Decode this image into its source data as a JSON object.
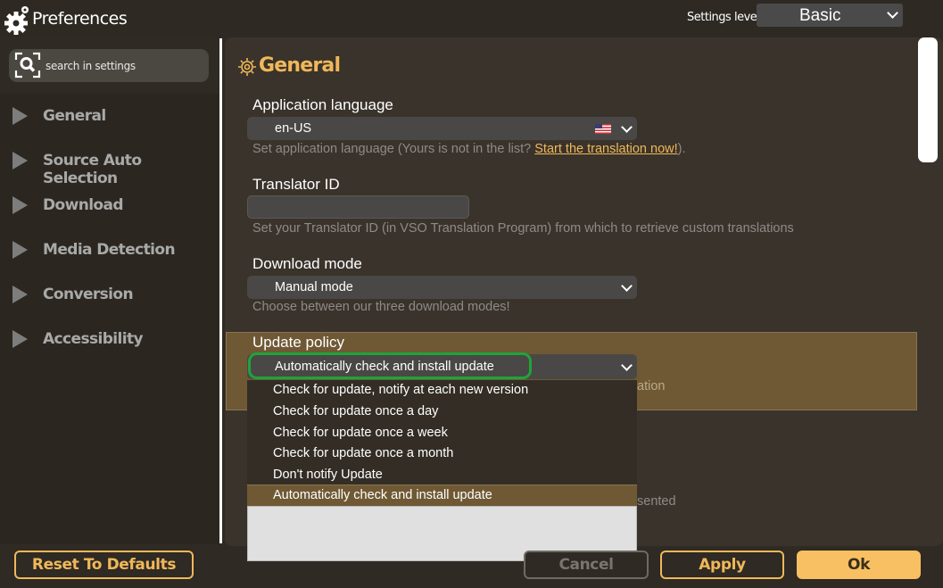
{
  "window": {
    "title": "Preferences"
  },
  "settings_level": {
    "label": "Settings level",
    "value": "Basic"
  },
  "search": {
    "placeholder": "search in settings"
  },
  "sidebar": {
    "items": [
      {
        "label": "General"
      },
      {
        "label": "Source Auto Selection"
      },
      {
        "label": "Download"
      },
      {
        "label": "Media Detection"
      },
      {
        "label": "Conversion"
      },
      {
        "label": "Accessibility"
      }
    ]
  },
  "section": {
    "title": "General"
  },
  "app_language": {
    "label": "Application language",
    "value": "en-US",
    "hint_prefix": "Set application language (Yours is not in the list? ",
    "hint_link": "Start the translation now!",
    "hint_suffix": ")."
  },
  "translator": {
    "label": "Translator ID",
    "value": "",
    "hint": "Set your Translator ID (in VSO Translation Program) from which to retrieve custom translations"
  },
  "download_mode": {
    "label": "Download mode",
    "value": "Manual mode",
    "hint": "Choose between our three download modes!"
  },
  "update_policy": {
    "label": "Update policy",
    "value": "Automatically check and install update",
    "hint_fragment": "ation",
    "options": [
      "Check for update, notify at each new version",
      "Check for update once a day",
      "Check for update once a week",
      "Check for update once a month",
      "Don't notify Update",
      "Automatically check and install update"
    ],
    "selected_index": 5
  },
  "hidden_hint_fragment": "sented",
  "buttons": {
    "reset": "Reset To Defaults",
    "cancel": "Cancel",
    "apply": "Apply",
    "ok": "Ok"
  },
  "colors": {
    "accent": "#f0b85a",
    "highlight_row": "#6f5934",
    "focus_ring": "#1fa33a"
  }
}
